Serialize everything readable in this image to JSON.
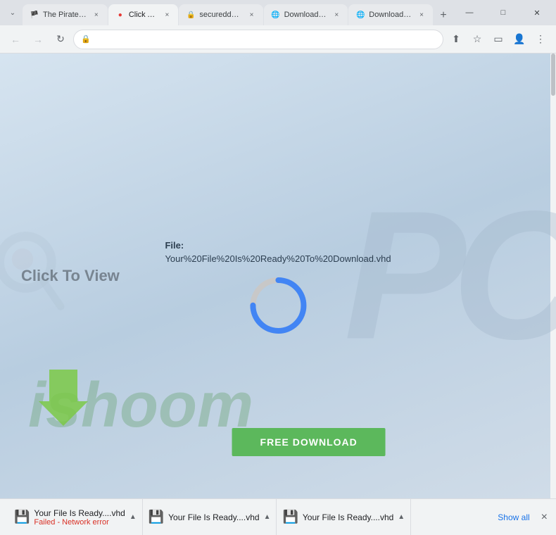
{
  "browser": {
    "tabs": [
      {
        "id": "tab1",
        "title": "The Pirate Ba...",
        "favicon": "🏴",
        "active": false,
        "close_label": "×"
      },
      {
        "id": "tab2",
        "title": "Click Allow",
        "favicon": "🔴",
        "active": true,
        "close_label": "×"
      },
      {
        "id": "tab3",
        "title": "secureddown...",
        "favicon": "🔒",
        "active": false,
        "close_label": "×"
      },
      {
        "id": "tab4",
        "title": "Download Re...",
        "favicon": "📄",
        "active": false,
        "close_label": "×"
      },
      {
        "id": "tab5",
        "title": "Download Re...",
        "favicon": "📄",
        "active": false,
        "close_label": "×"
      }
    ],
    "new_tab_label": "+",
    "window_controls": {
      "minimize": "—",
      "maximize": "□",
      "close": "✕"
    },
    "chevron_label": "⌄",
    "nav": {
      "back": "←",
      "forward": "→",
      "reload": "↻",
      "address": "",
      "lock_icon": "🔒"
    },
    "toolbar": {
      "share": "⬆",
      "bookmark": "☆",
      "browser_menu": "⋮",
      "cast": "▭",
      "profile": "👤"
    }
  },
  "page": {
    "background_text": "PC",
    "watermark_text": "ishoom",
    "click_to_view": "Click To View",
    "file_label": "File:",
    "file_name": "Your%20File%20Is%20Ready%20To%20Download.vhd",
    "spinner": {
      "progress": 75,
      "size": 90,
      "stroke_width": 8,
      "color_active": "#4285f4",
      "color_inactive": "#bdc1c6"
    },
    "download_button_label": "FREE DOWNLOAD"
  },
  "download_bar": {
    "items": [
      {
        "id": "dl1",
        "name": "Your File Is Ready....vhd",
        "status": "Failed - Network error",
        "icon": "💾"
      },
      {
        "id": "dl2",
        "name": "Your File Is Ready....vhd",
        "status": "",
        "icon": "💾"
      },
      {
        "id": "dl3",
        "name": "Your File Is Ready....vhd",
        "status": "",
        "icon": "💾"
      }
    ],
    "show_all_label": "Show all",
    "close_label": "×"
  }
}
